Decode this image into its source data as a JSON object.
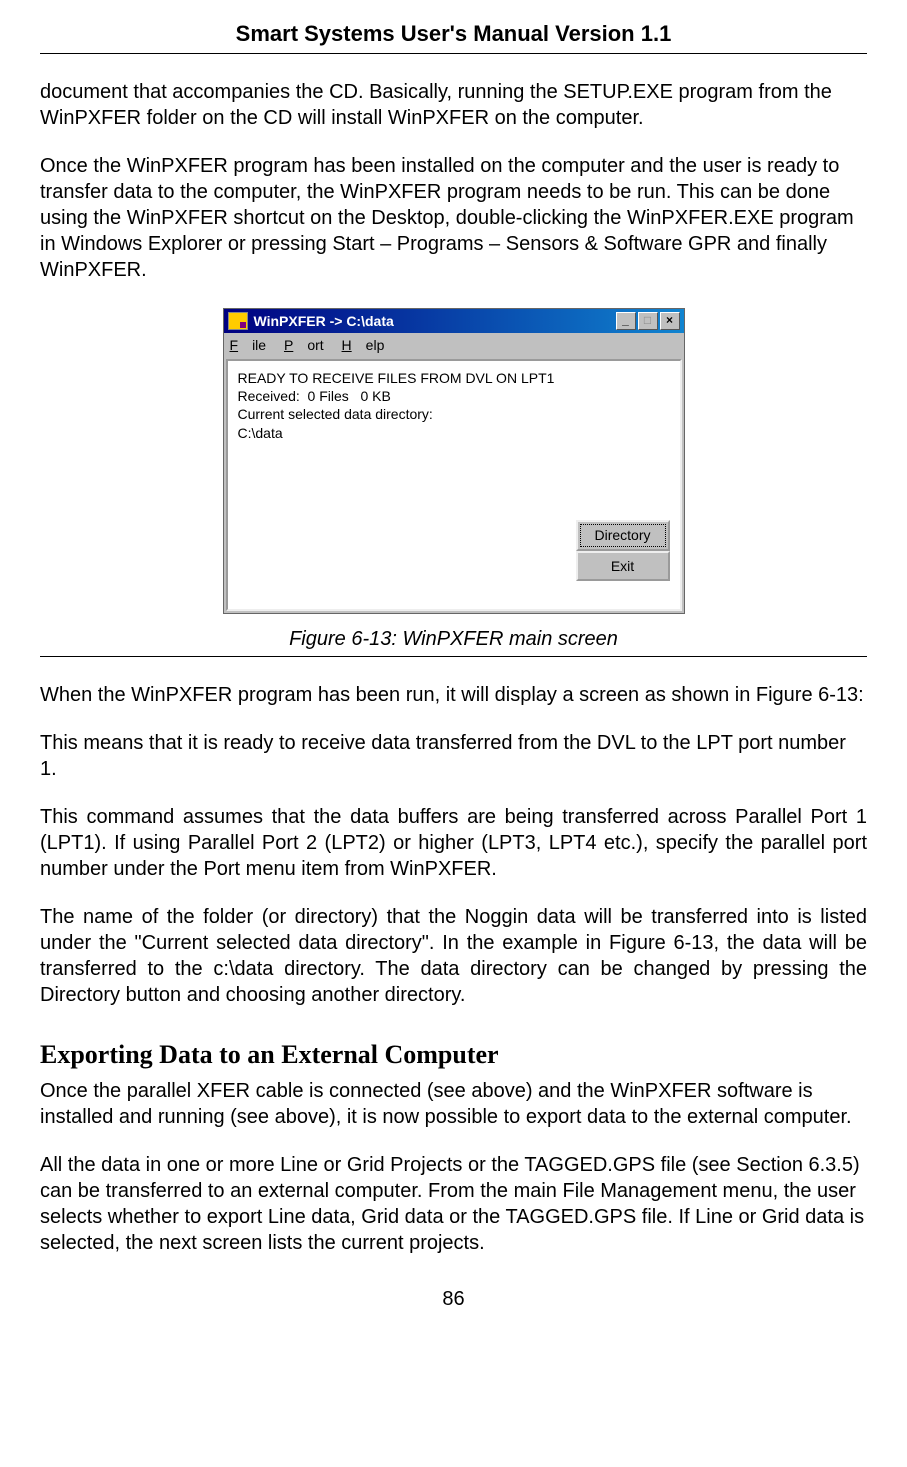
{
  "header": "Smart Systems User's Manual Version 1.1",
  "para1": "document that accompanies the CD.  Basically, running the SETUP.EXE program from the WinPXFER folder on the CD will install WinPXFER on the computer.",
  "para2": "Once the WinPXFER program has been installed on the computer and the user is ready to transfer data to the computer, the WinPXFER program needs to be run.  This can be done using the WinPXFER shortcut on the Desktop, double-clicking the WinPXFER.EXE program in Windows Explorer or pressing Start – Programs – Sensors & Software GPR and finally WinPXFER.",
  "app": {
    "title": "WinPXFER -> C:\\data",
    "menu": {
      "file": "File",
      "port": "Port",
      "help": "Help"
    },
    "status_line1": "READY TO RECEIVE FILES FROM DVL ON LPT1",
    "status_line2": "Received:  0 Files   0 KB",
    "status_line3": "Current selected data directory:",
    "status_line4": "C:\\data",
    "btn_dir": "Directory",
    "btn_exit": "Exit",
    "ctrl_min": "_",
    "ctrl_max": "□",
    "ctrl_close": "×"
  },
  "figure_caption": "Figure 6-13: WinPXFER main screen",
  "para3": "When the WinPXFER program has been run, it will display a screen as shown in Figure 6-13:",
  "para4": "This means that it is ready to receive data transferred from the DVL to the LPT port number 1.",
  "para5": "This command assumes that the data buffers are being transferred across Parallel Port 1 (LPT1). If using Parallel Port 2 (LPT2) or higher (LPT3, LPT4 etc.), specify the parallel port number under the Port menu item from WinPXFER.",
  "para6": "The name of the folder (or directory) that the Noggin data will be transferred into is listed under the \"Current selected data directory\".  In the example in Figure 6-13, the data will be transferred to the c:\\data directory.  The data directory can be changed by pressing the Directory button and choosing another directory.",
  "heading2": "Exporting Data to an External Computer",
  "para7": "Once the parallel XFER cable is connected (see above) and the WinPXFER software is installed and running (see above), it is now possible to export data to the external computer.",
  "para8": "All the data in one or more Line or Grid Projects or the TAGGED.GPS file (see Section 6.3.5) can be transferred to an external computer. From the main File Management menu, the user selects whether to export Line data, Grid data or the TAGGED.GPS file. If Line or Grid data is selected, the next screen lists the current projects.",
  "page_number": "86"
}
